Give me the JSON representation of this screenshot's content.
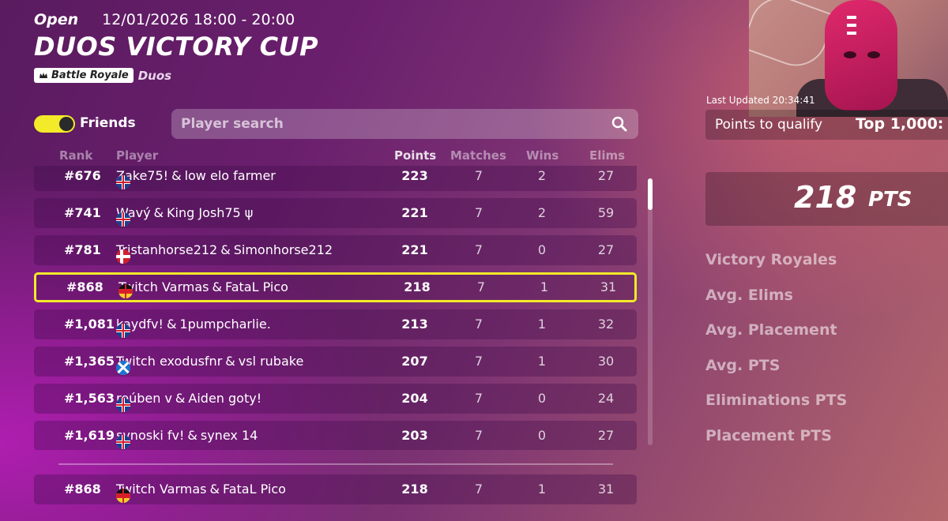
{
  "event": {
    "status": "Open",
    "time": "12/01/2026 18:00 - 20:00",
    "title": "DUOS VICTORY CUP",
    "tag_mode": "Battle Royale",
    "team_type": "Duos"
  },
  "controls": {
    "friends_label": "Friends",
    "friends_toggle_on": true,
    "search_placeholder": "Player search"
  },
  "columns": {
    "rank": "Rank",
    "player": "Player",
    "points": "Points",
    "matches": "Matches",
    "wins": "Wins",
    "elims": "Elims"
  },
  "rows": [
    {
      "rank": "#676",
      "p1_flag": "gb",
      "p1": "Zake75!",
      "p2_flag": "gb",
      "p2": "low elo farmer",
      "points": "223",
      "matches": "7",
      "wins": "2",
      "elims": "27"
    },
    {
      "rank": "#741",
      "p1_flag": "se",
      "p1": "Wavý",
      "p2_flag": "gb",
      "p2": "King Josh75 ψ",
      "points": "221",
      "matches": "7",
      "wins": "2",
      "elims": "59"
    },
    {
      "rank": "#781",
      "p1_flag": "dk",
      "p1": "Tristanhorse212",
      "p2_flag": "dk",
      "p2": "Simonhorse212",
      "points": "221",
      "matches": "7",
      "wins": "0",
      "elims": "27"
    },
    {
      "rank": "#868",
      "p1_flag": "gb",
      "p1": "Twitch Varmas",
      "p2_flag": "de",
      "p2": "FataL Pico",
      "points": "218",
      "matches": "7",
      "wins": "1",
      "elims": "31"
    },
    {
      "rank": "#1,081",
      "p1_flag": "gb",
      "p1": "kaydfv!",
      "p2_flag": "gb",
      "p2": "1pumpcharlie.",
      "points": "213",
      "matches": "7",
      "wins": "1",
      "elims": "32"
    },
    {
      "rank": "#1,365",
      "p1_flag": "de",
      "p1": "Twitch exodusfnr",
      "p2_flag": "sc",
      "p2": "vsl rubake",
      "points": "207",
      "matches": "7",
      "wins": "1",
      "elims": "30"
    },
    {
      "rank": "#1,563",
      "p1_flag": "se",
      "p1": "reúben v",
      "p2_flag": "gb",
      "p2": "Aiden goty!",
      "points": "204",
      "matches": "7",
      "wins": "0",
      "elims": "24"
    },
    {
      "rank": "#1,619",
      "p1_flag": "sc",
      "p1": "synoski fv!",
      "p2_flag": "gb",
      "p2": "synex 14",
      "points": "203",
      "matches": "7",
      "wins": "0",
      "elims": "27"
    }
  ],
  "pinned": {
    "rank": "#868",
    "p1_flag": "gb",
    "p1": "Twitch Varmas",
    "p2_flag": "de",
    "p2": "FataL Pico",
    "points": "218",
    "matches": "7",
    "wins": "1",
    "elims": "31"
  },
  "sidebar": {
    "last_updated": "Last Updated 20:34:41",
    "qualify_label": "Points to qualify",
    "qualify_value": "Top 1,000:",
    "points_value": "218",
    "points_unit": "PTS",
    "stats": [
      "Victory Royales",
      "Avg. Elims",
      "Avg. Placement",
      "Avg. PTS",
      "Eliminations PTS",
      "Placement PTS"
    ]
  },
  "colors": {
    "highlight": "#f3ea2a",
    "toggle": "#f3ea2a"
  }
}
